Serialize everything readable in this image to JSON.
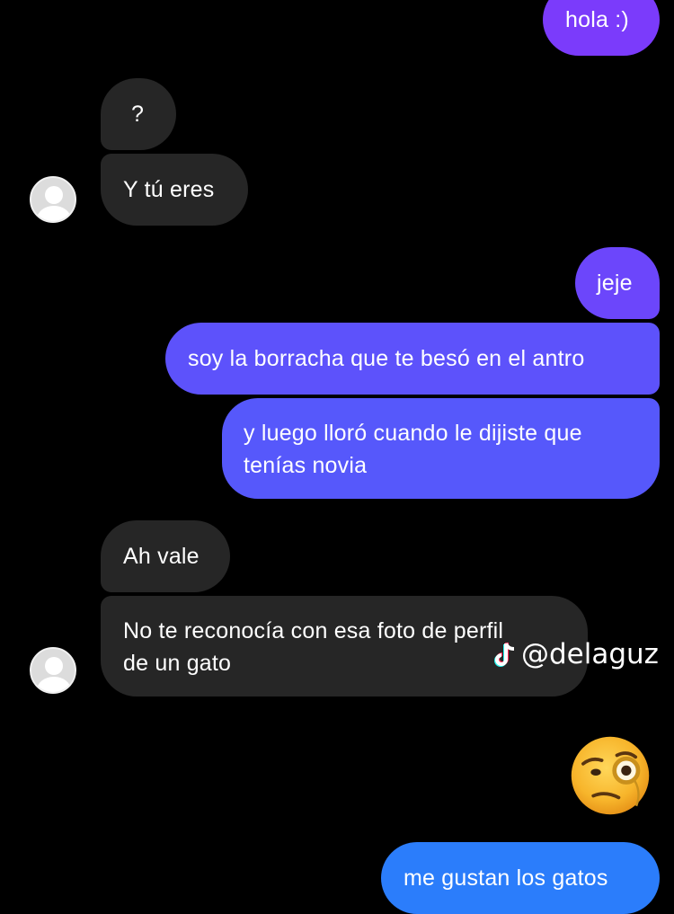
{
  "messages": [
    {
      "from": "me",
      "text": "hola :)"
    },
    {
      "from": "them",
      "text": "?"
    },
    {
      "from": "them",
      "text": "Y tú eres"
    },
    {
      "from": "me",
      "text": "jeje"
    },
    {
      "from": "me",
      "text": "soy la borracha que te besó en el antro"
    },
    {
      "from": "me",
      "line1": "y luego lloró cuando le dijiste que",
      "line2": "tenías novia"
    },
    {
      "from": "them",
      "text": "Ah vale"
    },
    {
      "from": "them",
      "line1": "No te reconocía con esa foto de perfil",
      "line2": "de un gato"
    },
    {
      "from": "me",
      "text": "me gustan los gatos"
    }
  ],
  "watermark": {
    "handle": "@delaguz",
    "icon": "tiktok-icon"
  },
  "reaction": {
    "icon": "face-with-monocle-emoji"
  },
  "colors": {
    "background": "#000000",
    "incoming_bubble": "#262626",
    "outgoing_purple": "#7a3cfb",
    "outgoing_indigo": "#5b55fb",
    "outgoing_blue": "#2a7dfb",
    "text": "#ffffff"
  }
}
